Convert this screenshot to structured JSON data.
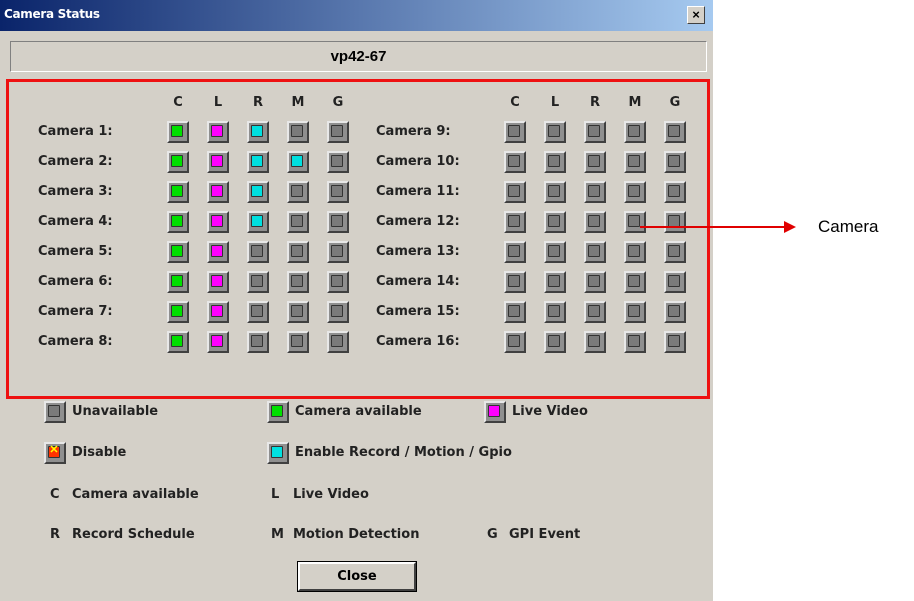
{
  "window": {
    "title": "Camera Status",
    "close_glyph": "×"
  },
  "server_name": "vp42-67",
  "column_headers": [
    "C",
    "L",
    "R",
    "M",
    "G"
  ],
  "cameras": [
    {
      "label": "Camera 1:",
      "states": [
        "green",
        "magenta",
        "cyan",
        "off",
        "off"
      ]
    },
    {
      "label": "Camera 2:",
      "states": [
        "green",
        "magenta",
        "cyan",
        "cyan",
        "off"
      ]
    },
    {
      "label": "Camera 3:",
      "states": [
        "green",
        "magenta",
        "cyan",
        "off",
        "off"
      ]
    },
    {
      "label": "Camera 4:",
      "states": [
        "green",
        "magenta",
        "cyan",
        "off",
        "off"
      ]
    },
    {
      "label": "Camera 5:",
      "states": [
        "green",
        "magenta",
        "off",
        "off",
        "off"
      ]
    },
    {
      "label": "Camera 6:",
      "states": [
        "green",
        "magenta",
        "off",
        "off",
        "off"
      ]
    },
    {
      "label": "Camera 7:",
      "states": [
        "green",
        "magenta",
        "off",
        "off",
        "off"
      ]
    },
    {
      "label": "Camera 8:",
      "states": [
        "green",
        "magenta",
        "off",
        "off",
        "off"
      ]
    },
    {
      "label": "Camera 9:",
      "states": [
        "off",
        "off",
        "off",
        "off",
        "off"
      ]
    },
    {
      "label": "Camera 10:",
      "states": [
        "off",
        "off",
        "off",
        "off",
        "off"
      ]
    },
    {
      "label": "Camera 11:",
      "states": [
        "off",
        "off",
        "off",
        "off",
        "off"
      ]
    },
    {
      "label": "Camera 12:",
      "states": [
        "off",
        "off",
        "off",
        "off",
        "off"
      ]
    },
    {
      "label": "Camera 13:",
      "states": [
        "off",
        "off",
        "off",
        "off",
        "off"
      ]
    },
    {
      "label": "Camera 14:",
      "states": [
        "off",
        "off",
        "off",
        "off",
        "off"
      ]
    },
    {
      "label": "Camera 15:",
      "states": [
        "off",
        "off",
        "off",
        "off",
        "off"
      ]
    },
    {
      "label": "Camera 16:",
      "states": [
        "off",
        "off",
        "off",
        "off",
        "off"
      ]
    }
  ],
  "legend": {
    "unavailable": "Unavailable",
    "camera_available": "Camera available",
    "live_video": "Live Video",
    "disable": "Disable",
    "enable_record": "Enable Record / Motion / Gpio"
  },
  "abbreviations": {
    "c_key": "C",
    "c_text": "Camera available",
    "l_key": "L",
    "l_text": "Live Video",
    "r_key": "R",
    "r_text": "Record Schedule",
    "m_key": "M",
    "m_text": "Motion Detection",
    "g_key": "G",
    "g_text": "GPI Event"
  },
  "close_button_label": "Close",
  "callout_label": "Camera",
  "colors": {
    "green": "#00e000",
    "magenta": "#ff00ff",
    "cyan": "#00e0e0",
    "off": "#7a7a7a",
    "disable": "#ff3300",
    "highlight": "#ee1111"
  }
}
